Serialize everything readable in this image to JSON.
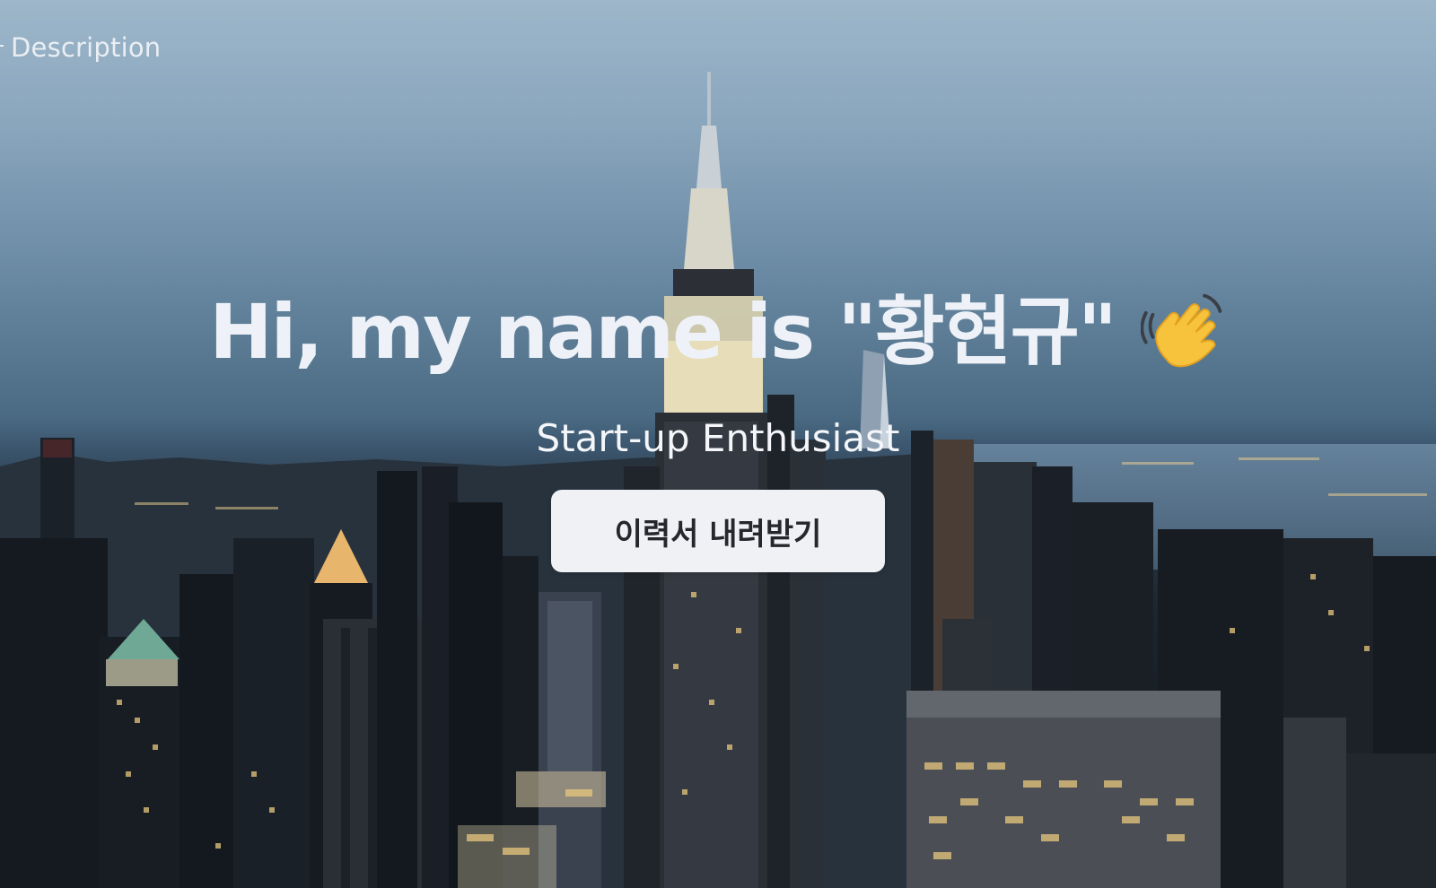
{
  "nav": {
    "description_link": "Description"
  },
  "hero": {
    "headline": "Hi, my name is \"황현규\"",
    "wave_emoji": "👋",
    "tagline": "Start-up Enthusiast",
    "download_button_label": "이력서 내려받기"
  },
  "colors": {
    "text_primary": "#eef2f8",
    "button_background": "#f0f1f4",
    "button_text": "#25272c",
    "sky_top": "#9db6ca",
    "city_dark": "#12161c"
  }
}
